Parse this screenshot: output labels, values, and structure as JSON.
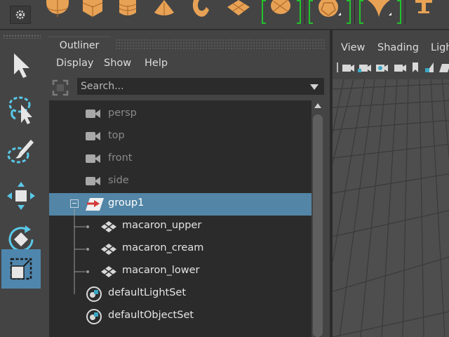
{
  "shelf": {
    "icons": [
      "settings-gear-icon",
      "sphere-icon",
      "cube-icon",
      "cylinder-icon",
      "cone-icon",
      "torus-icon",
      "plane-icon",
      "disc-icon",
      "soccer-ball-icon",
      "star-icon",
      "text-icon"
    ]
  },
  "toolbox": {
    "tools": [
      "select-tool",
      "lasso-tool",
      "paint-select-tool",
      "move-tool",
      "rotate-tool",
      "scale-tool"
    ],
    "active_tool": "scale-tool"
  },
  "outliner": {
    "tab_label": "Outliner",
    "menu": [
      "Display",
      "Show",
      "Help"
    ],
    "search_placeholder": "Search...",
    "items": [
      {
        "label": "persp",
        "icon": "camera-icon",
        "kind": "camera"
      },
      {
        "label": "top",
        "icon": "camera-icon",
        "kind": "camera"
      },
      {
        "label": "front",
        "icon": "camera-icon",
        "kind": "camera"
      },
      {
        "label": "side",
        "icon": "camera-icon",
        "kind": "camera"
      },
      {
        "label": "group1",
        "icon": "group-transform-icon",
        "kind": "group",
        "selected": true,
        "expanded": true
      },
      {
        "label": "macaron_upper",
        "icon": "mesh-icon",
        "kind": "child"
      },
      {
        "label": "macaron_cream",
        "icon": "mesh-icon",
        "kind": "child"
      },
      {
        "label": "macaron_lower",
        "icon": "mesh-icon",
        "kind": "child"
      },
      {
        "label": "defaultLightSet",
        "icon": "set-icon",
        "kind": "set"
      },
      {
        "label": "defaultObjectSet",
        "icon": "set-icon",
        "kind": "set"
      }
    ]
  },
  "viewport": {
    "menu": [
      "View",
      "Shading",
      "Ligh"
    ]
  },
  "colors": {
    "accent": "#5285a6",
    "shelf_icon": "#e8a255",
    "tool_icon": "#5ac8e8"
  }
}
